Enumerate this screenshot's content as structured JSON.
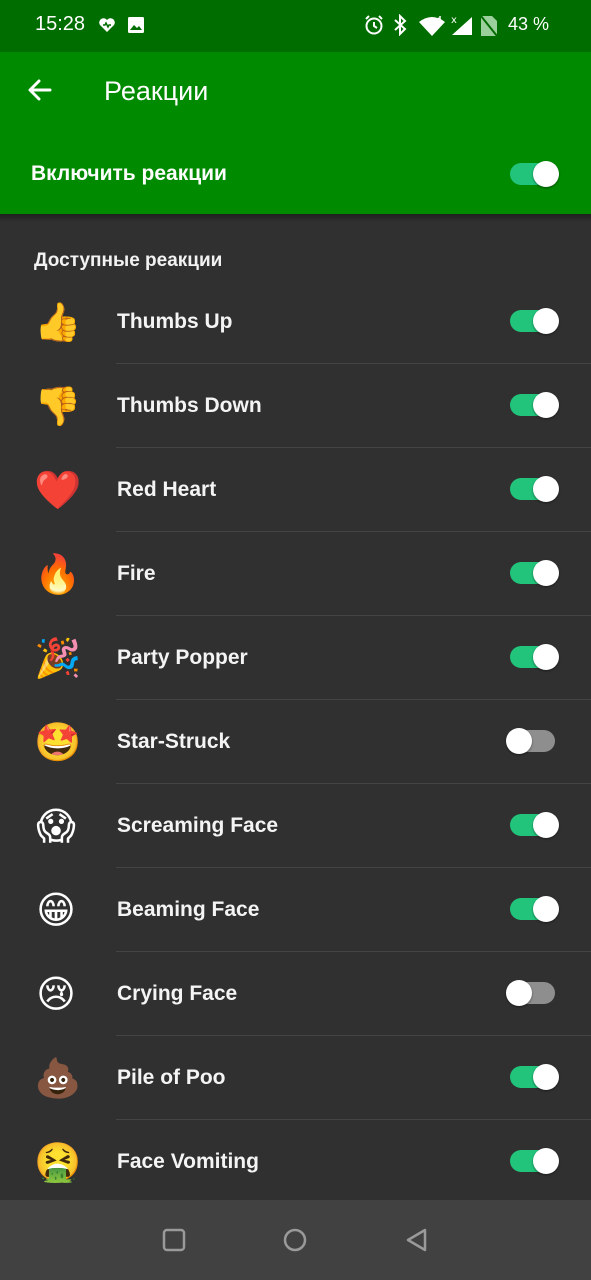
{
  "status_bar": {
    "time": "15:28",
    "battery": "43 %",
    "icons": [
      "heart-icon",
      "image-icon",
      "alarm-icon",
      "bluetooth-icon",
      "wifi-icon",
      "signal-icon",
      "no-sim-icon"
    ]
  },
  "app_bar": {
    "title": "Реакции",
    "back_icon": "arrow-left-icon"
  },
  "master_toggle": {
    "label": "Включить реакции",
    "enabled": true
  },
  "section": {
    "title": "Доступные реакции"
  },
  "reactions": [
    {
      "emoji": "👍",
      "label": "Thumbs Up",
      "enabled": true
    },
    {
      "emoji": "👎",
      "label": "Thumbs Down",
      "enabled": true
    },
    {
      "emoji": "❤️",
      "label": "Red Heart",
      "enabled": true
    },
    {
      "emoji": "🔥",
      "label": "Fire",
      "enabled": true
    },
    {
      "emoji": "🎉",
      "label": "Party Popper",
      "enabled": true
    },
    {
      "emoji": "🤩",
      "label": "Star-Struck",
      "enabled": false
    },
    {
      "emoji": "😱",
      "label": "Screaming Face",
      "enabled": true
    },
    {
      "emoji": "😁",
      "label": "Beaming Face",
      "enabled": true
    },
    {
      "emoji": "😢",
      "label": "Crying Face",
      "enabled": false
    },
    {
      "emoji": "💩",
      "label": "Pile of Poo",
      "enabled": true
    },
    {
      "emoji": "🤮",
      "label": "Face Vomiting",
      "enabled": true
    }
  ],
  "nav_bar": {
    "icons": [
      "recents-square-icon",
      "home-circle-icon",
      "back-triangle-icon"
    ]
  },
  "colors": {
    "status_bar": "#006d00",
    "app_bar": "#008a00",
    "background": "#303030",
    "switch_on": "#21c47a",
    "switch_off": "#8e8e8e",
    "nav_bar": "#414141"
  }
}
